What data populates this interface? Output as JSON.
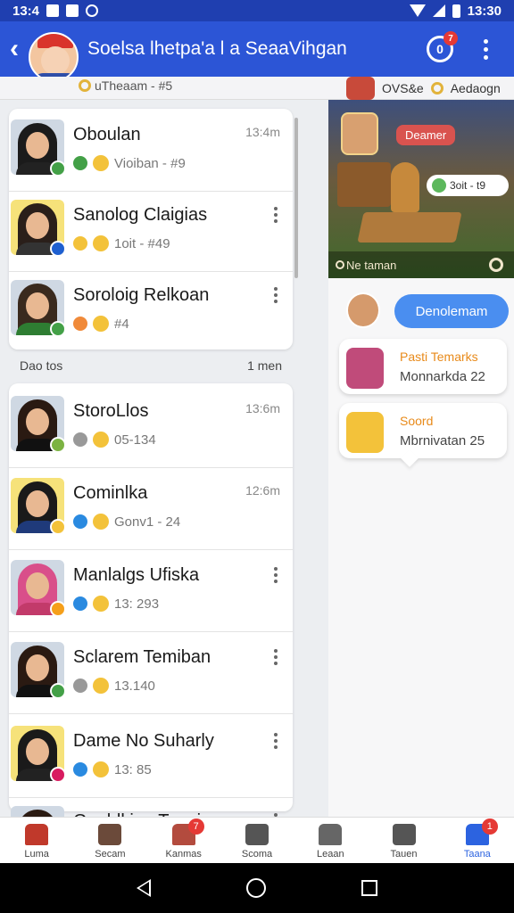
{
  "status_bar": {
    "time": "13:4",
    "clock": "13:30"
  },
  "app_bar": {
    "title": "Soelsa lhetpa'a l a  SeaaVihgan",
    "notif_badge": "7"
  },
  "subheader": {
    "left_text": "uTheaam  - #5",
    "right_text": "OVS&e",
    "right_text2": "Aedaogn"
  },
  "chat_list": {
    "section_label": "Dao tos",
    "section_right": "1 men",
    "items": [
      {
        "name": "Oboulan",
        "meta": "Vioiban - #9",
        "time": "13:4m",
        "has_menu": false,
        "hair": "#1b1b1b",
        "shirt": "#222",
        "badge": "#43a047",
        "meta_icon": "#43a047"
      },
      {
        "name": "Sanolog Claigias",
        "meta": "1oit -  #49",
        "time": "",
        "has_menu": true,
        "hair": "#2a1f1a",
        "shirt": "#333",
        "badge": "#1e5fd0",
        "meta_icon": "#f3c23a"
      },
      {
        "name": "Soroloig Relkoan",
        "meta": "#4",
        "time": "",
        "has_menu": true,
        "hair": "#3a2a1e",
        "shirt": "#2e7d32",
        "badge": "#43a047",
        "meta_icon": "#f08a3a"
      },
      {
        "name": "StoroLlos",
        "meta": "05-134",
        "time": "13:6m",
        "has_menu": false,
        "hair": "#2a1a12",
        "shirt": "#111",
        "badge": "#7cb342",
        "meta_icon": "#999"
      },
      {
        "name": "Cominlka",
        "meta": "Gonv1 - 24",
        "time": "12:6m",
        "has_menu": false,
        "hair": "#1a1a1a",
        "shirt": "#1f3a7a",
        "badge": "#f3c23a",
        "meta_icon": "#2a8ae0"
      },
      {
        "name": "Manlalgs Ufiska",
        "meta": "13: 293",
        "time": "",
        "has_menu": true,
        "hair": "#d94f8a",
        "shirt": "#c23a6a",
        "badge": "#f59f1a",
        "meta_icon": "#2a8ae0"
      },
      {
        "name": "Sclarem Temiban",
        "meta": "13.140",
        "time": "",
        "has_menu": true,
        "hair": "#2a1a12",
        "shirt": "#111",
        "badge": "#43a047",
        "meta_icon": "#999"
      },
      {
        "name": "Dame No Suharly",
        "meta": "13: 85",
        "time": "",
        "has_menu": true,
        "hair": "#1a1a1a",
        "shirt": "#222",
        "badge": "#d81b60",
        "meta_icon": "#2a8ae0"
      },
      {
        "name": "Genblkiee Tenpiam",
        "meta": "",
        "time": "",
        "has_menu": true,
        "hair": "#2a1a12",
        "shirt": "#111",
        "badge": "#43a047",
        "meta_icon": "#999"
      }
    ]
  },
  "game_panel": {
    "pill": "Deamer",
    "tag": "3oit - t9",
    "bar_text": "Ne taman"
  },
  "conversation": {
    "my_bubble": "Denolemam",
    "messages": [
      {
        "title": "Pasti Temarks",
        "subtitle": "Monnarkda 22"
      },
      {
        "title": "Soord",
        "subtitle": "Mbrnivatan 25"
      }
    ]
  },
  "tabs": [
    {
      "label": "Luma",
      "color": "#c0392b",
      "badge": ""
    },
    {
      "label": "Secam",
      "color": "#6b4a3a",
      "badge": ""
    },
    {
      "label": "Kanmas",
      "color": "#b34b3e",
      "badge": "7"
    },
    {
      "label": "Scoma",
      "color": "#555",
      "badge": ""
    },
    {
      "label": "Leaan",
      "color": "#666",
      "badge": ""
    },
    {
      "label": "Tauen",
      "color": "#555",
      "badge": ""
    },
    {
      "label": "Taana",
      "color": "#2c63e0",
      "badge": "1"
    }
  ],
  "colors": {
    "appbar": "#2c55d6",
    "statusbar": "#1f3fb0",
    "accent": "#4a8ef0"
  }
}
